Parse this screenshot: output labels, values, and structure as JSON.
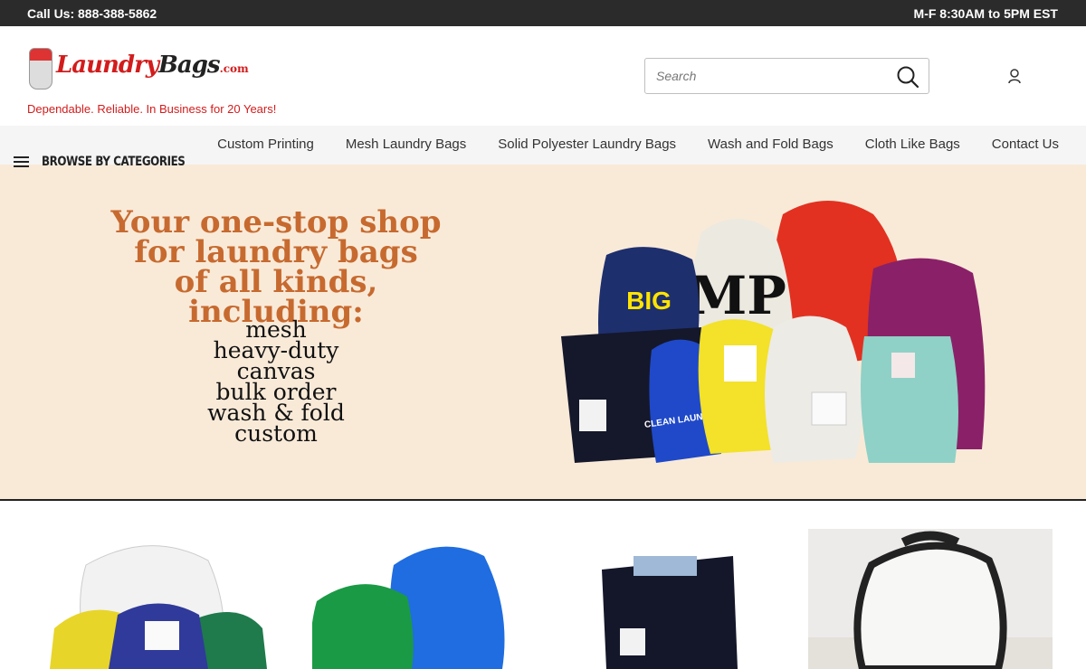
{
  "topbar": {
    "phone": "Call Us: 888-388-5862",
    "hours": "M-F 8:30AM to 5PM EST"
  },
  "header": {
    "logo": {
      "part1": "Laundry",
      "part2": "Bags",
      "part3": ".com"
    },
    "tagline": "Dependable. Reliable. In Business for 20 Years!",
    "search_placeholder": "Search",
    "search_value": ""
  },
  "nav": {
    "browse_label": "Browse by Categories",
    "links": [
      "Custom Printing",
      "Mesh Laundry Bags",
      "Solid Polyester Laundry Bags",
      "Wash and Fold Bags",
      "Cloth Like Bags",
      "Contact Us"
    ]
  },
  "hero": {
    "headline": [
      "Your one-stop shop",
      "for laundry bags",
      "of all kinds, including:"
    ],
    "items": [
      "mesh",
      "heavy-duty",
      "canvas",
      "bulk order",
      "wash & fold",
      "custom"
    ],
    "bag_labels": {
      "big": "BIG",
      "mp": "MP",
      "clean": "CLEAN LAUNDRY"
    }
  },
  "colors": {
    "topbar": "#2b2b2b",
    "brand_red": "#d21c1c",
    "hero_bg": "#f9ead8",
    "headline": "#c76a2f"
  },
  "icons": {
    "search": "magnifier-icon",
    "account": "user-icon",
    "menu": "hamburger-icon"
  }
}
